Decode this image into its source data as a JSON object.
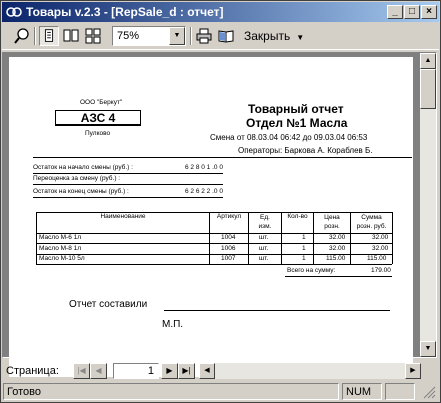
{
  "window": {
    "title": "Товары v.2.3 - [RepSale_d : отчет]",
    "minimize": "_",
    "maximize": "□",
    "close": "×"
  },
  "toolbar": {
    "zoom": "75%",
    "close_label": "Закрыть"
  },
  "report": {
    "company": "ООО \"Беркут\"",
    "station": "АЗС 4",
    "place": "Пулково",
    "title": "Товарный отчет",
    "department": "Отдел №1 Масла",
    "shift": "Смена от 08.03.04 06:42 до 09.03.04 06:53",
    "operators": "Операторы: Баркова А. Кораблев Б.",
    "balance_start_label": "Остаток на начало смены (руб.) :",
    "balance_start_value": "6 2 8 0 1 .0 0",
    "reprice_label": "Переоценка за смену (руб.) :",
    "balance_end_label": "Остаток на конец смены (руб.) :",
    "balance_end_value": "6 2 6 2 2 .0 0",
    "table": {
      "headers": [
        "Наименование",
        "Артикул",
        "Ед.\nизм.",
        "Кол-во",
        "Цена\nрозн.",
        "Сумма\nрозн. руб."
      ],
      "rows": [
        [
          "Масло  М-6  1л",
          "1004",
          "шт.",
          "1",
          "32.00",
          "32.00"
        ],
        [
          "Масло  М-8  1л",
          "1006",
          "шт.",
          "1",
          "32.00",
          "32.00"
        ],
        [
          "Масло  М-10  5л",
          "1007",
          "шт.",
          "1",
          "115.00",
          "115.00"
        ]
      ],
      "total_label": "Всего на сумму:",
      "total_value": "179.00"
    },
    "compiled_by": "Отчет составили",
    "stamp": "М.П."
  },
  "pager": {
    "label": "Страница:",
    "page": "1"
  },
  "status": {
    "ready": "Готово",
    "num": "NUM"
  }
}
